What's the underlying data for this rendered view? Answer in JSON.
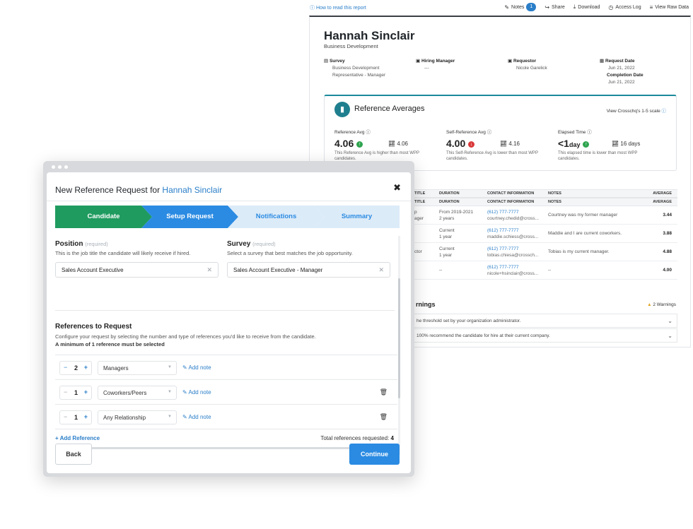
{
  "report": {
    "toolbar": {
      "how_to": "How to read this report",
      "notes_label": "Notes",
      "notes_count": "1",
      "share": "Share",
      "download": "Download",
      "access_log": "Access Log",
      "view_raw": "View Raw Data"
    },
    "candidate": {
      "name": "Hannah Sinclair",
      "role": "Business Development"
    },
    "meta": {
      "survey_label": "Survey",
      "survey_value_1": "Business Development",
      "survey_value_2": "Representative - Manager",
      "hiring_manager_label": "Hiring Manager",
      "hiring_manager_value": "---",
      "requestor_label": "Requestor",
      "requestor_value": "Nicole Garelick",
      "request_date_label": "Request Date",
      "request_date_value": "Jun 21, 2022",
      "completion_date_label": "Completion Date",
      "completion_date_value": "Jun 21, 2022"
    },
    "averages": {
      "title": "Reference Averages",
      "scale_link": "View Crosschq's 1-5 scale",
      "cols": [
        {
          "label": "Reference Avg",
          "value": "4.06",
          "trend": "4.06",
          "desc": "This Reference Avg is higher than most WPP candidates.",
          "dot_color": "#2ea44f",
          "dot": "↑"
        },
        {
          "label": "Self-Reference Avg",
          "value": "4.00",
          "trend": "4.16",
          "desc": "This Self-Reference Avg is lower than most WPP candidates.",
          "dot_color": "#d93838",
          "dot": "↓"
        },
        {
          "label": "Elapsed Time",
          "value": "<1",
          "value_unit": "day",
          "trend": "16 days",
          "desc": "This elapsed time is lower than most WPP candidates.",
          "dot_color": "#2ea44f",
          "dot": "↑"
        }
      ]
    },
    "table": {
      "headers": [
        "TITLE",
        "DURATION",
        "CONTACT INFORMATION",
        "NOTES",
        "AVERAGE"
      ],
      "rows": [
        {
          "title": "p",
          "title_2": "ager",
          "duration": "From 2019-2021",
          "duration_2": "2 years",
          "phone": "(612) 777-7777",
          "email": "courtney.chedid@cross...",
          "notes": "Courtney was my former manager",
          "avg": "3.44"
        },
        {
          "title": "",
          "title_2": "",
          "duration": "Current",
          "duration_2": "1 year",
          "phone": "(612) 777-7777",
          "email": "maddie.schiess@cross...",
          "notes": "Maddie and I are current coworkers.",
          "avg": "3.88"
        },
        {
          "title": "",
          "title_2": "ctor",
          "duration": "Current",
          "duration_2": "1 year",
          "phone": "(612) 777-7777",
          "email": "tobias.chiesa@crossch...",
          "notes": "Tobias is my current manager.",
          "avg": "4.88"
        },
        {
          "title": "",
          "title_2": "",
          "duration": "--",
          "duration_2": "",
          "phone": "(612) 777-7777",
          "email": "nicole+hsinclair@cross...",
          "notes": "--",
          "avg": "4.00"
        }
      ]
    },
    "warnings": {
      "title": "rnings",
      "count": "2 Warnings",
      "items": [
        "he threshold set by your organization administrator.",
        "100% recommend the candidate for hire at their current company."
      ]
    }
  },
  "modal": {
    "title_prefix": "New Reference Request for",
    "title_name": "Hannah Sinclair",
    "close": "✖",
    "steps": [
      {
        "label": "Candidate",
        "state": "done"
      },
      {
        "label": "Setup Request",
        "state": "active"
      },
      {
        "label": "Notifications",
        "state": "pending"
      },
      {
        "label": "Summary",
        "state": "pending"
      }
    ],
    "position": {
      "label": "Position",
      "required": "(required)",
      "help": "This is the job title the candidate will likely receive if hired.",
      "value": "Sales Account Executive"
    },
    "survey": {
      "label": "Survey",
      "required": "(required)",
      "help": "Select a survey that best matches the job opportunity.",
      "value": "Sales Account Executive - Manager"
    },
    "references": {
      "title": "References to Request",
      "description": "Configure your request by selecting the number and type of references you'd like to receive from the candidate.",
      "minimum": "A minimum of 1 reference must be selected",
      "items": [
        {
          "count": "2",
          "relationship": "Managers",
          "add_note": "Add note",
          "deletable": false
        },
        {
          "count": "1",
          "relationship": "Coworkers/Peers",
          "add_note": "Add note",
          "deletable": true
        },
        {
          "count": "1",
          "relationship": "Any Relationship",
          "add_note": "Add note",
          "deletable": true
        }
      ],
      "add_reference": "Add Reference",
      "total_label": "Total references requested:",
      "total_value": "4"
    },
    "back": "Back",
    "continue": "Continue"
  },
  "colors": {
    "step_done": "#1f9b5f",
    "step_active": "#2b8be2",
    "step_pending": "#dcebf8",
    "accent": "#2a7ec8"
  }
}
